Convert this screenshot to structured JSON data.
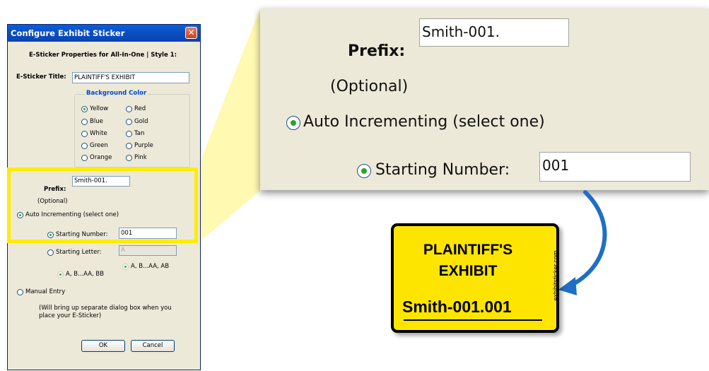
{
  "dialog": {
    "title": "Configure Exhibit Sticker",
    "close_glyph": "✕",
    "heading": "E-Sticker Properties for All-In-One | Style 1:",
    "title_label": "E-Sticker Title:",
    "title_value": "PLAINTIFF'S EXHIBIT",
    "bg_group_label": "Background Color",
    "colors": [
      "Yellow",
      "Red",
      "Blue",
      "Gold",
      "White",
      "Tan",
      "Green",
      "Purple",
      "Orange",
      "Pink"
    ],
    "selected_color": "Yellow",
    "prefix_label": "Prefix:",
    "prefix_value": "Smith-001.",
    "optional_label": "(Optional)",
    "auto_inc_label": "Auto Incrementing (select one)",
    "starting_number_label": "Starting Number:",
    "starting_number_value": "001",
    "starting_letter_label": "Starting Letter:",
    "starting_letter_value": "A",
    "letter_option_1": "A, B...AA, BB",
    "letter_option_2": "A, B...AA, AB",
    "manual_entry_label": "Manual Entry",
    "manual_note_1": "(Will bring up separate dialog box when you",
    "manual_note_2": "place your E-Sticker)",
    "ok_label": "OK",
    "cancel_label": "Cancel"
  },
  "zoom": {
    "prefix_label": "Prefix:",
    "prefix_value": "Smith-001.",
    "optional_label": "(Optional)",
    "auto_inc_label": "Auto Incrementing (select one)",
    "starting_number_label": "Starting Number:",
    "starting_number_value": "001"
  },
  "sticker": {
    "line1": "PLAINTIFF'S",
    "line2": "EXHIBIT",
    "number": "Smith-001.001",
    "vertical_text": "exhibitsticker.com"
  },
  "colors": {
    "highlight": "#ffec00",
    "callout_fill": "#fff8a8",
    "sticker_bg": "#fee500",
    "arrow": "#1f6fc4",
    "titlebar": "#0a4fc4"
  }
}
